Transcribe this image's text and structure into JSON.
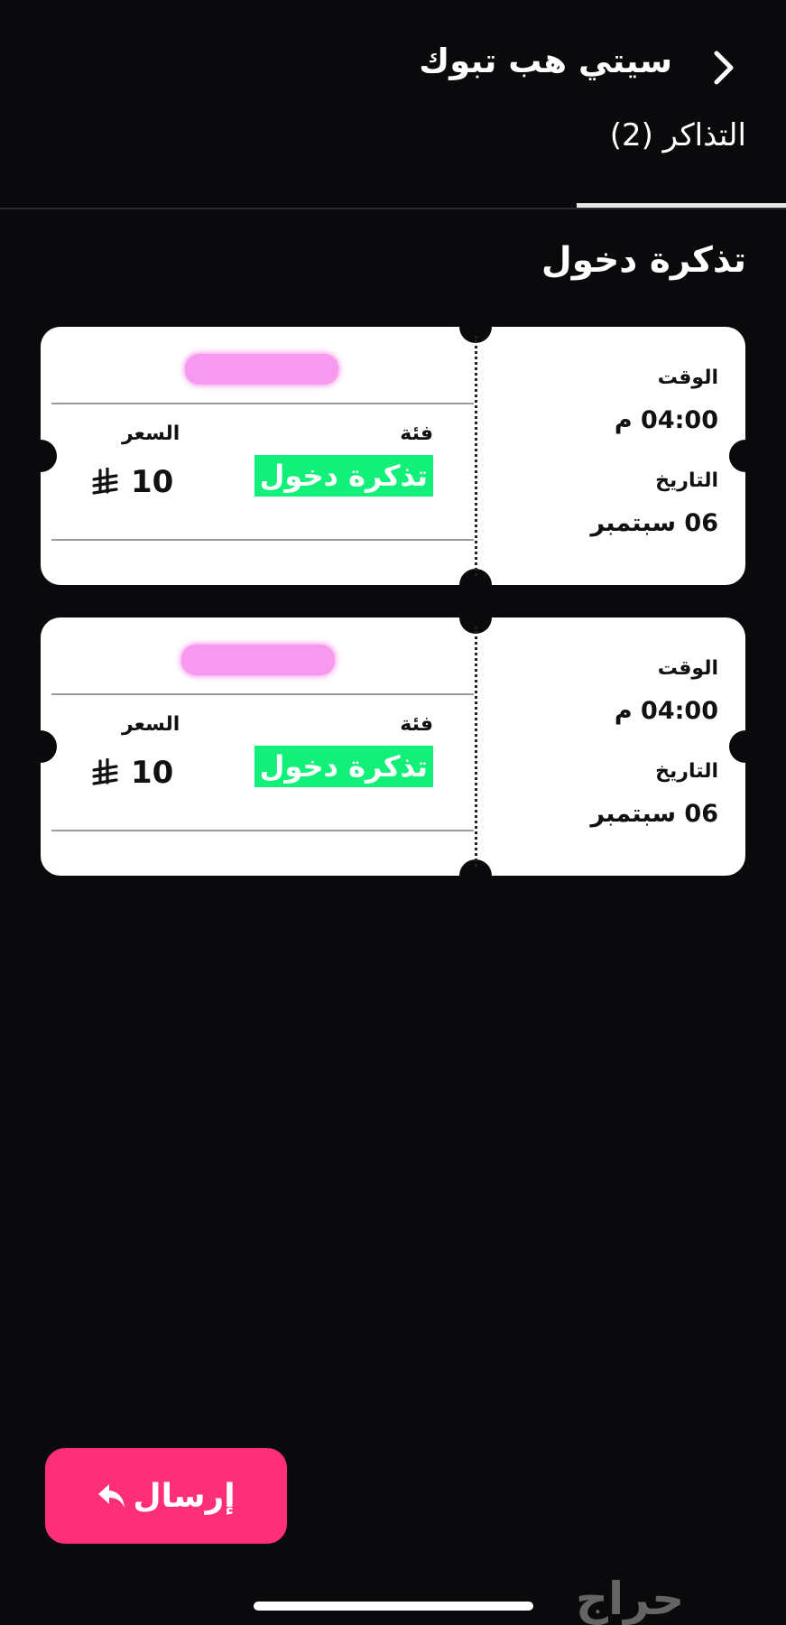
{
  "header": {
    "title": "سيتي هب تبوك",
    "tab_label": "التذاكر (2)"
  },
  "section_title": "تذكرة دخول",
  "tickets": [
    {
      "time_label": "الوقت",
      "time_value": "04:00 م",
      "date_label": "التاريخ",
      "date_value": "06 سبتمبر",
      "category_label": "فئة",
      "category_value": "تذكرة دخول",
      "price_label": "السعر",
      "price_value": "10"
    },
    {
      "time_label": "الوقت",
      "time_value": "04:00 م",
      "date_label": "التاريخ",
      "date_value": "06 سبتمبر",
      "category_label": "فئة",
      "category_value": "تذكرة دخول",
      "price_label": "السعر",
      "price_value": "10"
    }
  ],
  "send_button": {
    "label": "إرسال",
    "icon": "reply-arrow-icon"
  },
  "watermark": "حراج",
  "colors": {
    "background": "#0a0a0c",
    "accent_button": "#ff2e78",
    "category_badge": "#13f07a",
    "ticket_bg": "#ffffff"
  }
}
